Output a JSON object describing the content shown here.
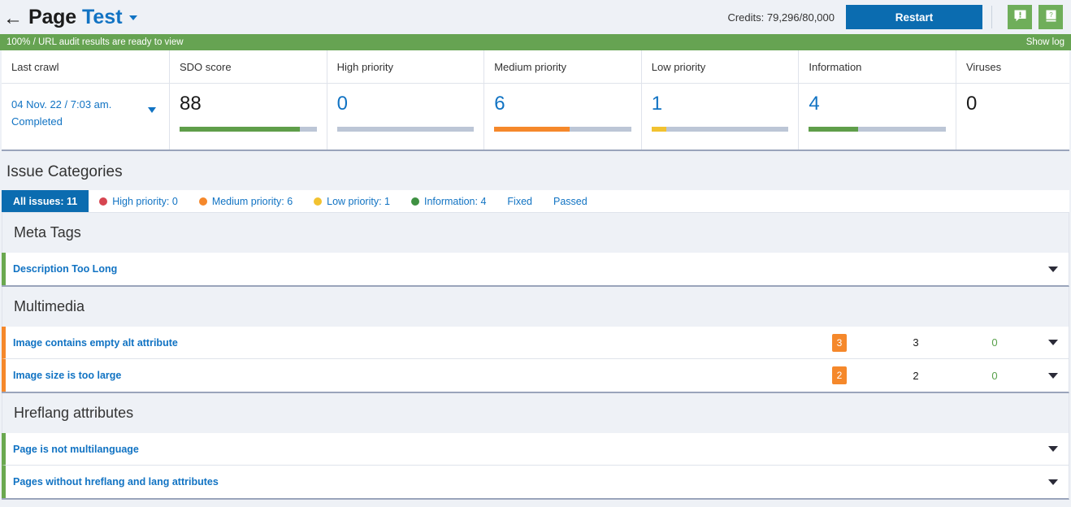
{
  "header": {
    "back_icon": "arrow-left-icon",
    "title": "Page",
    "site_name": "Test",
    "credits": "Credits: 79,296/80,000",
    "restart_label": "Restart",
    "feedback_icon": "speech-bubble-alert-icon",
    "help_icon": "help-book-icon"
  },
  "status": {
    "message": "100% / URL audit results are ready to view",
    "show_log_label": "Show log",
    "banner_color": "#66a352"
  },
  "metrics": {
    "columns": [
      {
        "header": "Last crawl",
        "line1": "04 Nov. 22 / 7:03 am.",
        "line2": "Completed"
      },
      {
        "header": "SDO score",
        "value": "88",
        "bar_percent": 88,
        "bar_color": "#5f9e4a",
        "link": false
      },
      {
        "header": "High priority",
        "value": "0",
        "bar_percent": 0,
        "bar_color": "#d64550",
        "link": true
      },
      {
        "header": "Medium priority",
        "value": "6",
        "bar_percent": 55,
        "bar_color": "#f5882b",
        "link": true
      },
      {
        "header": "Low priority",
        "value": "1",
        "bar_percent": 11,
        "bar_color": "#f2c230",
        "link": true
      },
      {
        "header": "Information",
        "value": "4",
        "bar_percent": 36,
        "bar_color": "#5f9e4a",
        "link": true
      },
      {
        "header": "Viruses",
        "value": "0",
        "bar_percent": null,
        "bar_color": null,
        "link": false
      }
    ]
  },
  "issue_categories": {
    "section_title": "Issue Categories",
    "tabs": [
      {
        "label": "All issues: 11",
        "dot": null,
        "active": true
      },
      {
        "label": "High priority: 0",
        "dot": "#d64550",
        "active": false
      },
      {
        "label": "Medium priority: 6",
        "dot": "#f5882b",
        "active": false
      },
      {
        "label": "Low priority: 1",
        "dot": "#f2c230",
        "active": false
      },
      {
        "label": "Information: 4",
        "dot": "#3f9142",
        "active": false
      },
      {
        "label": "Fixed",
        "dot": null,
        "active": false
      },
      {
        "label": "Passed",
        "dot": null,
        "active": false
      }
    ],
    "groups": [
      {
        "name": "Meta Tags",
        "rows": [
          {
            "name": "Description Too Long",
            "accent": "#6aa84f",
            "badge": null,
            "total": null,
            "fixed": null
          }
        ]
      },
      {
        "name": "Multimedia",
        "rows": [
          {
            "name": "Image contains empty alt attribute",
            "accent": "#f5882b",
            "badge": "3",
            "total": "3",
            "fixed": "0"
          },
          {
            "name": "Image size is too large",
            "accent": "#f5882b",
            "badge": "2",
            "total": "2",
            "fixed": "0"
          }
        ]
      },
      {
        "name": "Hreflang attributes",
        "rows": [
          {
            "name": "Page is not multilanguage",
            "accent": "#6aa84f",
            "badge": null,
            "total": null,
            "fixed": null
          },
          {
            "name": "Pages without hreflang and lang attributes",
            "accent": "#6aa84f",
            "badge": null,
            "total": null,
            "fixed": null
          }
        ]
      }
    ]
  }
}
